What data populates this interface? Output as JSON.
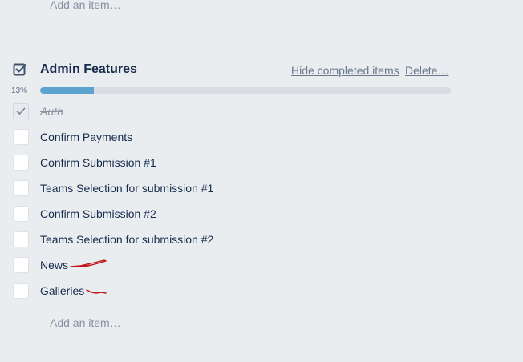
{
  "top_add_item": "Add an item…",
  "checklist": {
    "title": "Admin Features",
    "icon": "checklist-icon",
    "hide_completed_label": "Hide completed items",
    "delete_label": "Delete…",
    "progress_text": "13%",
    "progress_value": 0.13,
    "items": [
      {
        "label": "Auth",
        "checked": true
      },
      {
        "label": "Confirm Payments",
        "checked": false
      },
      {
        "label": "Confirm Submission #1",
        "checked": false
      },
      {
        "label": "Teams Selection for submission #1",
        "checked": false
      },
      {
        "label": "Confirm Submission #2",
        "checked": false
      },
      {
        "label": "Teams Selection for submission #2",
        "checked": false
      },
      {
        "label": "News",
        "checked": false
      },
      {
        "label": "Galleries",
        "checked": false
      }
    ],
    "add_item_label": "Add an item…"
  },
  "colors": {
    "background": "#e9edf0",
    "progress_fill": "#5ba4cf",
    "progress_track": "#d9dde3",
    "annotation": "#c0151a"
  }
}
